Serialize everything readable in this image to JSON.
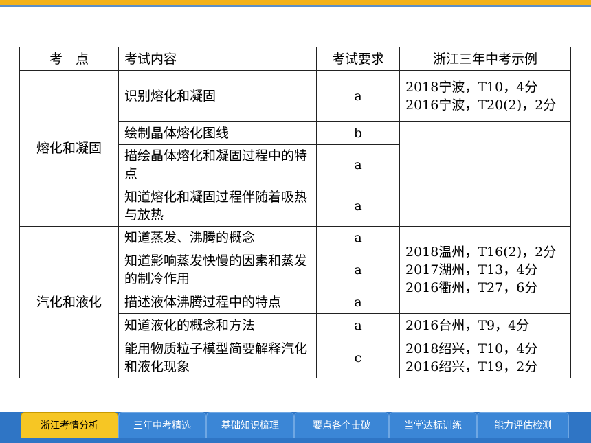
{
  "header": {
    "col1": "考　点",
    "col2": "考试内容",
    "col3": "考试要求",
    "col4": "浙江三年中考示例"
  },
  "groups": [
    {
      "point": "熔化和凝固",
      "rows": [
        {
          "content": "识别熔化和凝固",
          "req": "a",
          "examples": [
            "2018宁波，T10，4分",
            "2016宁波，T20(2)，2分"
          ]
        },
        {
          "content": "绘制晶体熔化图线",
          "req": "b"
        },
        {
          "content": "描绘晶体熔化和凝固过程中的特点",
          "req": "a"
        },
        {
          "content": "知道熔化和凝固过程伴随着吸热与放热",
          "req": "a"
        }
      ]
    },
    {
      "point": "汽化和液化",
      "rows": [
        {
          "content": "知道蒸发、沸腾的概念",
          "req": "a",
          "examples": [
            "2018温州，T16(2)，2分",
            "2017湖州，T13，4分",
            "2016衢州，T27，6分"
          ]
        },
        {
          "content": "知道影响蒸发快慢的因素和蒸发的制冷作用",
          "req": "a"
        },
        {
          "content": "描述液体沸腾过程中的特点",
          "req": "a"
        },
        {
          "content": "知道液化的概念和方法",
          "req": "a",
          "examples": [
            "2016台州，T9，4分"
          ]
        },
        {
          "content": "能用物质粒子模型简要解释汽化和液化现象",
          "req": "c",
          "examples": [
            "2018绍兴，T10，4分",
            "2016绍兴，T19，2分"
          ]
        }
      ]
    }
  ],
  "nav": {
    "tabs": [
      "浙江考情分析",
      "三年中考精选",
      "基础知识梳理",
      "要点各个击破",
      "当堂达标训练",
      "能力评估检测"
    ],
    "active": 0,
    "active_color": "#f6c624",
    "tab_color": "#3b86d6"
  }
}
